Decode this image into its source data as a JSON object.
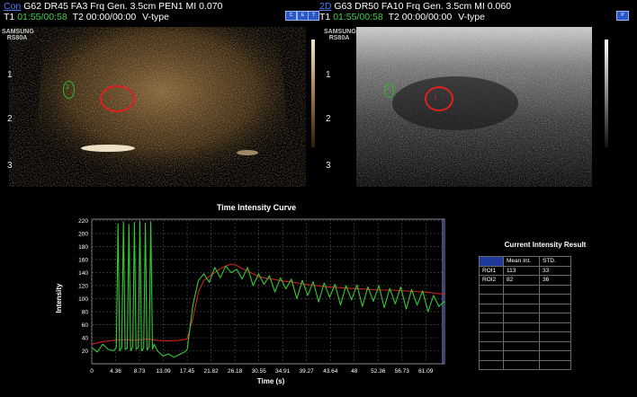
{
  "left_header": {
    "mode": "Con",
    "params": "G62 DR45 FA3 Frq Gen. 3.5cm PEN1 MI 0.070",
    "t1_label": "T1",
    "t1_value": "01:55/00:58",
    "t2_label": "T2",
    "t2_value": "00:00/00:00",
    "vtype": "V-type"
  },
  "right_header": {
    "mode": "2D",
    "params": "G63 DR50 FA10 Frq Gen. 3.5cm MI 0.060",
    "t1_label": "T1",
    "t1_value": "01:55/00:58",
    "t2_label": "T2",
    "t2_value": "00:00/00:00",
    "vtype": "V-type"
  },
  "device_label": "SAMSUNG\nRS80A",
  "depth_ticks": [
    "1",
    "2",
    "3"
  ],
  "roi_labels": [
    "1",
    "2"
  ],
  "colors": {
    "roi1": "#e02020",
    "roi2": "#2fb82f",
    "mode_blue": "#4d7cff",
    "green_text": "#3fd14a"
  },
  "chart_data": {
    "type": "line",
    "title": "Time Intensity Curve",
    "xlabel": "Time (s)",
    "ylabel": "Intensity",
    "x_ticks": [
      "0",
      "4.36",
      "8.73",
      "13.09",
      "17.45",
      "21.82",
      "26.18",
      "30.55",
      "34.91",
      "39.27",
      "43.64",
      "48",
      "52.36",
      "56.73",
      "61.09"
    ],
    "y_ticks": [
      "20",
      "40",
      "60",
      "80",
      "100",
      "120",
      "140",
      "160",
      "180",
      "200",
      "220"
    ],
    "xlim": [
      0,
      64.5
    ],
    "ylim": [
      0,
      222
    ],
    "grid": true,
    "series": [
      {
        "color": "#d12020",
        "x": [
          0,
          2,
          4,
          6,
          8,
          10,
          12,
          14,
          16,
          17.45,
          18.5,
          19.5,
          20.5,
          21.5,
          22.5,
          23.5,
          24.5,
          25.5,
          26.5,
          27.5,
          28.5,
          29.5,
          30.5,
          31.5,
          33,
          35,
          37,
          39,
          41,
          43,
          45,
          47,
          49,
          51,
          53,
          55,
          57,
          59,
          61,
          63,
          64.5
        ],
        "y": [
          30,
          34,
          36,
          37,
          36,
          38,
          36,
          35,
          36,
          38,
          70,
          110,
          128,
          134,
          140,
          146,
          150,
          153,
          151,
          146,
          143,
          138,
          134,
          132,
          130,
          127,
          125,
          122,
          120,
          118,
          117,
          116,
          115,
          114,
          113,
          113,
          112,
          111,
          110,
          108,
          107
        ]
      },
      {
        "color": "#35c935",
        "x": [
          0,
          1,
          2,
          3,
          4,
          4.5,
          4.8,
          5.1,
          5.5,
          5.8,
          6.1,
          6.5,
          6.8,
          7.1,
          7.5,
          7.8,
          8.1,
          8.5,
          8.8,
          9.1,
          9.5,
          9.8,
          10.1,
          10.5,
          10.8,
          11.1,
          11.4,
          12,
          13,
          14,
          15,
          16,
          17,
          17.45,
          18.5,
          19.5,
          20.5,
          21.5,
          22.5,
          23.5,
          24.5,
          25.5,
          26.5,
          27.5,
          28.5,
          29.5,
          30.5,
          31.5,
          32.5,
          33.5,
          34.5,
          35.5,
          36.5,
          37.5,
          38.5,
          39.5,
          40.5,
          41.5,
          42.5,
          43.5,
          44.5,
          45.5,
          46.5,
          47.5,
          48.5,
          49.5,
          50.5,
          51.5,
          52.5,
          53.5,
          54.5,
          55.5,
          56.5,
          57.5,
          58.5,
          59.5,
          60.5,
          61.5,
          62.5,
          63.5,
          64.5
        ],
        "y": [
          25,
          18,
          30,
          22,
          20,
          25,
          215,
          20,
          25,
          218,
          22,
          24,
          214,
          20,
          26,
          217,
          22,
          25,
          219,
          20,
          24,
          216,
          21,
          26,
          218,
          22,
          30,
          20,
          12,
          15,
          10,
          14,
          18,
          22,
          90,
          128,
          138,
          125,
          148,
          132,
          150,
          140,
          145,
          130,
          148,
          120,
          138,
          122,
          135,
          110,
          132,
          115,
          130,
          100,
          128,
          105,
          126,
          95,
          124,
          102,
          122,
          90,
          120,
          98,
          121,
          88,
          118,
          96,
          120,
          86,
          116,
          92,
          118,
          84,
          114,
          90,
          112,
          80,
          105,
          88,
          96
        ]
      }
    ]
  },
  "result_table": {
    "title": "Current Intensity Result",
    "headers": [
      "",
      "Mean Int.",
      "STD."
    ],
    "rows": [
      [
        "ROI1",
        "113",
        "33"
      ],
      [
        "ROI2",
        "82",
        "36"
      ],
      [
        "",
        "",
        ""
      ],
      [
        "",
        "",
        ""
      ],
      [
        "",
        "",
        ""
      ],
      [
        "",
        "",
        ""
      ],
      [
        "",
        "",
        ""
      ],
      [
        "",
        "",
        ""
      ],
      [
        "",
        "",
        ""
      ],
      [
        "",
        "",
        ""
      ],
      [
        "",
        "",
        ""
      ]
    ]
  }
}
